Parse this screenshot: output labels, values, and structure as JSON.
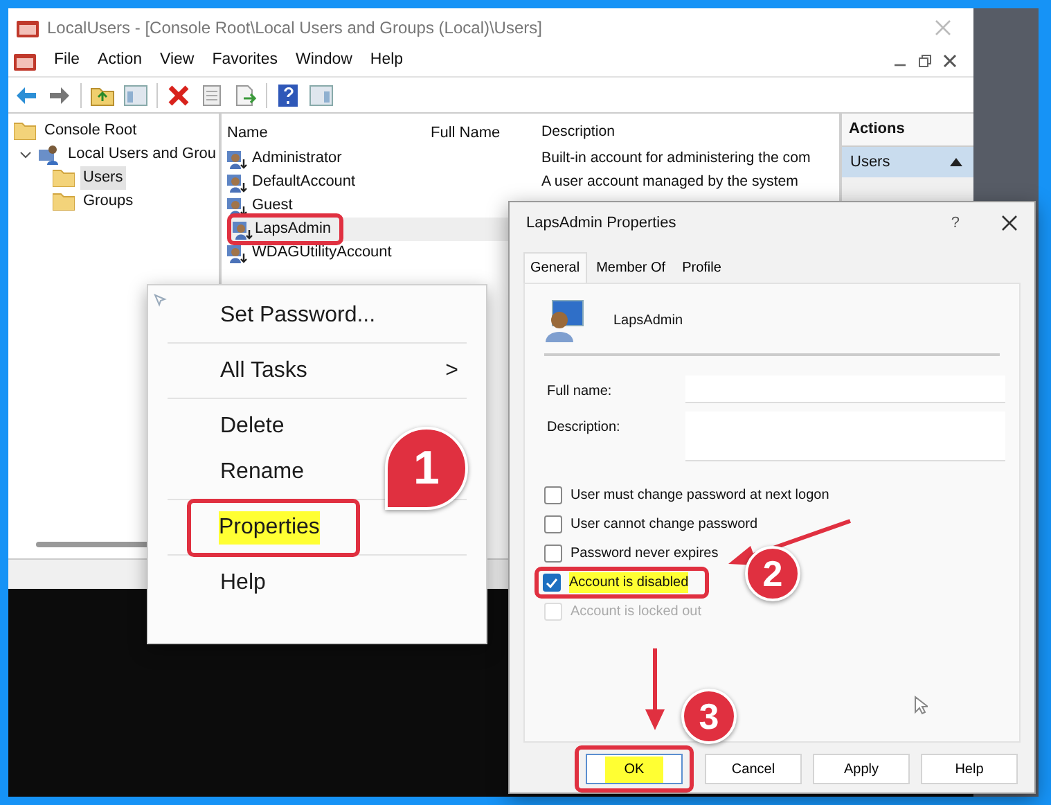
{
  "main_window": {
    "title": "LocalUsers - [Console Root\\Local Users and Groups (Local)\\Users]",
    "menu": [
      "File",
      "Action",
      "View",
      "Favorites",
      "Window",
      "Help"
    ],
    "tree": [
      {
        "label": "Console Root",
        "kind": "folder",
        "children": [
          {
            "label": "Local Users and Grou",
            "kind": "snap_in",
            "expanded": true,
            "children": [
              {
                "label": "Users",
                "kind": "folder",
                "selected": true
              },
              {
                "label": "Groups",
                "kind": "folder",
                "selected": false
              }
            ]
          }
        ]
      }
    ],
    "columns": [
      "Name",
      "Full Name",
      "Description"
    ],
    "rows": [
      {
        "name": "Administrator",
        "description": "Built-in account for administering the com",
        "selected": false,
        "red_frame": false
      },
      {
        "name": "DefaultAccount",
        "description": "A user account managed by the system",
        "selected": false,
        "red_frame": false
      },
      {
        "name": "Guest",
        "selected": false,
        "red_frame": false
      },
      {
        "name": "LapsAdmin",
        "selected": true,
        "red_frame": true
      },
      {
        "name": "WDAGUtilityAccount",
        "selected": false,
        "red_frame": false
      }
    ],
    "actions": {
      "header": "Actions",
      "items": [
        {
          "label": "Users",
          "selected": true
        }
      ]
    }
  },
  "context_menu": {
    "groups": [
      [
        {
          "label": "Set Password...",
          "red_frame": false,
          "yellow_mark": false
        }
      ],
      [
        {
          "label": "All Tasks",
          "arrow": ">",
          "red_frame": false,
          "yellow_mark": false
        }
      ],
      [
        {
          "label": "Delete",
          "red_frame": false,
          "yellow_mark": false
        },
        {
          "label": "Rename",
          "red_frame": false,
          "yellow_mark": false
        }
      ],
      [
        {
          "label": "Properties",
          "red_frame": true,
          "yellow_mark": true
        }
      ],
      [
        {
          "label": "Help",
          "red_frame": false,
          "yellow_mark": false
        }
      ]
    ]
  },
  "dialog": {
    "title": "LapsAdmin Properties",
    "help_glyph": "?",
    "tabs": [
      {
        "label": "General",
        "selected": true
      },
      {
        "label": "Member Of",
        "selected": false
      },
      {
        "label": "Profile",
        "selected": false
      }
    ],
    "user_name": "LapsAdmin",
    "fields": [
      {
        "label": "Full name:",
        "kind": "line"
      },
      {
        "label": "Description:",
        "kind": "area"
      }
    ],
    "checkboxes": [
      {
        "label": "User must change password at next logon",
        "checked": false,
        "disabled": false,
        "red_frame": false,
        "yellow_mark": false
      },
      {
        "label": "User cannot change password",
        "checked": false,
        "disabled": false,
        "red_frame": false,
        "yellow_mark": false
      },
      {
        "label": "Password never expires",
        "checked": false,
        "disabled": false,
        "red_frame": false,
        "yellow_mark": false
      },
      {
        "label": "Account is disabled",
        "checked": true,
        "disabled": false,
        "red_frame": true,
        "yellow_mark": true
      },
      {
        "label": "Account is locked out",
        "checked": false,
        "disabled": true,
        "red_frame": false,
        "yellow_mark": false
      }
    ],
    "buttons": [
      {
        "label": "OK",
        "default": true,
        "red_frame": true,
        "yellow_mark": true
      },
      {
        "label": "Cancel",
        "default": false,
        "red_frame": false,
        "yellow_mark": false
      },
      {
        "label": "Apply",
        "default": false,
        "red_frame": false,
        "yellow_mark": false
      },
      {
        "label": "Help",
        "default": false,
        "red_frame": false,
        "yellow_mark": false
      }
    ]
  },
  "steps": [
    {
      "number": "1",
      "kind": "pin"
    },
    {
      "number": "2",
      "kind": "circle"
    },
    {
      "number": "3",
      "kind": "circle"
    }
  ]
}
